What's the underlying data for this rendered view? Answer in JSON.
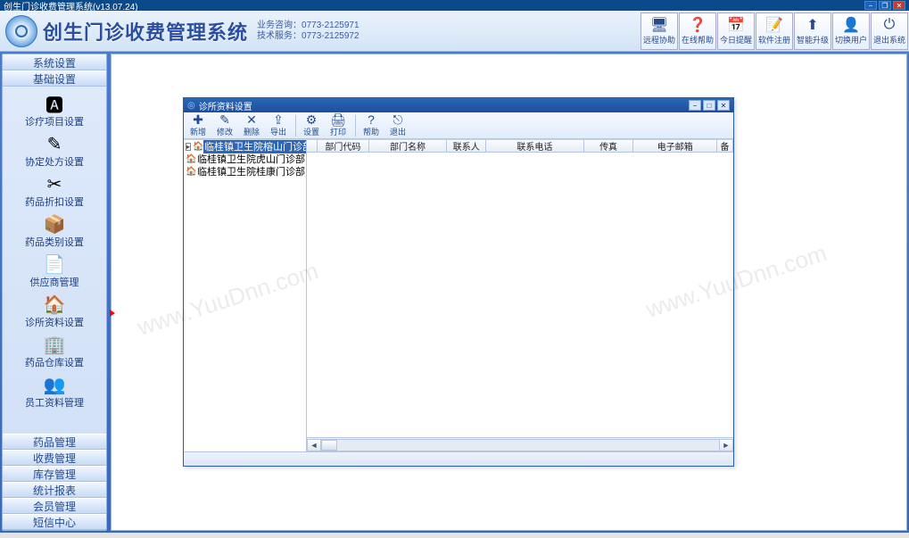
{
  "outer_window": {
    "title": "创生门诊收费管理系统(v13.07.24)"
  },
  "header": {
    "brand": "创生门诊收费管理系统",
    "contact_line1": "业务咨询：0773-2125971",
    "contact_line2": "技术服务：0773-2125972",
    "top_buttons": [
      {
        "label": "远程协助",
        "icon": "🖥"
      },
      {
        "label": "在线帮助",
        "icon": "❓"
      },
      {
        "label": "今日提醒",
        "icon": "📅"
      },
      {
        "label": "软件注册",
        "icon": "📝"
      },
      {
        "label": "智能升级",
        "icon": "⬆"
      },
      {
        "label": "切换用户",
        "icon": "👤"
      },
      {
        "label": "退出系统",
        "icon": "⏻"
      }
    ]
  },
  "sidebar": {
    "top_heads": [
      "系统设置",
      "基础设置"
    ],
    "items": [
      {
        "label": "诊疗项目设置",
        "icon": "🅰"
      },
      {
        "label": "协定处方设置",
        "icon": "✎"
      },
      {
        "label": "药品折扣设置",
        "icon": "✂"
      },
      {
        "label": "药品类别设置",
        "icon": "📦"
      },
      {
        "label": "供应商管理",
        "icon": "📄"
      },
      {
        "label": "诊所资料设置",
        "icon": "🏠"
      },
      {
        "label": "药品仓库设置",
        "icon": "🏢"
      },
      {
        "label": "员工资料管理",
        "icon": "👥"
      }
    ],
    "bottom_heads": [
      "药品管理",
      "收费管理",
      "库存管理",
      "统计报表",
      "会员管理",
      "短信中心"
    ]
  },
  "inner_window": {
    "title": "诊所资料设置",
    "toolbar": [
      {
        "label": "新增",
        "icon": "✚"
      },
      {
        "label": "修改",
        "icon": "✎"
      },
      {
        "label": "删除",
        "icon": "✕"
      },
      {
        "label": "导出",
        "icon": "⇪"
      },
      {
        "sep": true
      },
      {
        "label": "设置",
        "icon": "⚙"
      },
      {
        "label": "打印",
        "icon": "🖨"
      },
      {
        "sep": true
      },
      {
        "label": "帮助",
        "icon": "?"
      },
      {
        "label": "退出",
        "icon": "⎋"
      }
    ],
    "tree": [
      {
        "label": "临桂镇卫生院榕山门诊部",
        "selected": true,
        "toggle": "▸"
      },
      {
        "label": "临桂镇卫生院虎山门诊部",
        "selected": false
      },
      {
        "label": "临桂镇卫生院桂康门诊部",
        "selected": false
      }
    ],
    "grid_columns": [
      {
        "label": "部门代码",
        "w": 58
      },
      {
        "label": "部门名称",
        "w": 88
      },
      {
        "label": "联系人",
        "w": 44
      },
      {
        "label": "联系电话",
        "w": 110
      },
      {
        "label": "传真",
        "w": 56
      },
      {
        "label": "电子邮箱",
        "w": 94
      },
      {
        "label": "备",
        "w": 18
      }
    ]
  },
  "watermark": "www.YuuDnn.com"
}
